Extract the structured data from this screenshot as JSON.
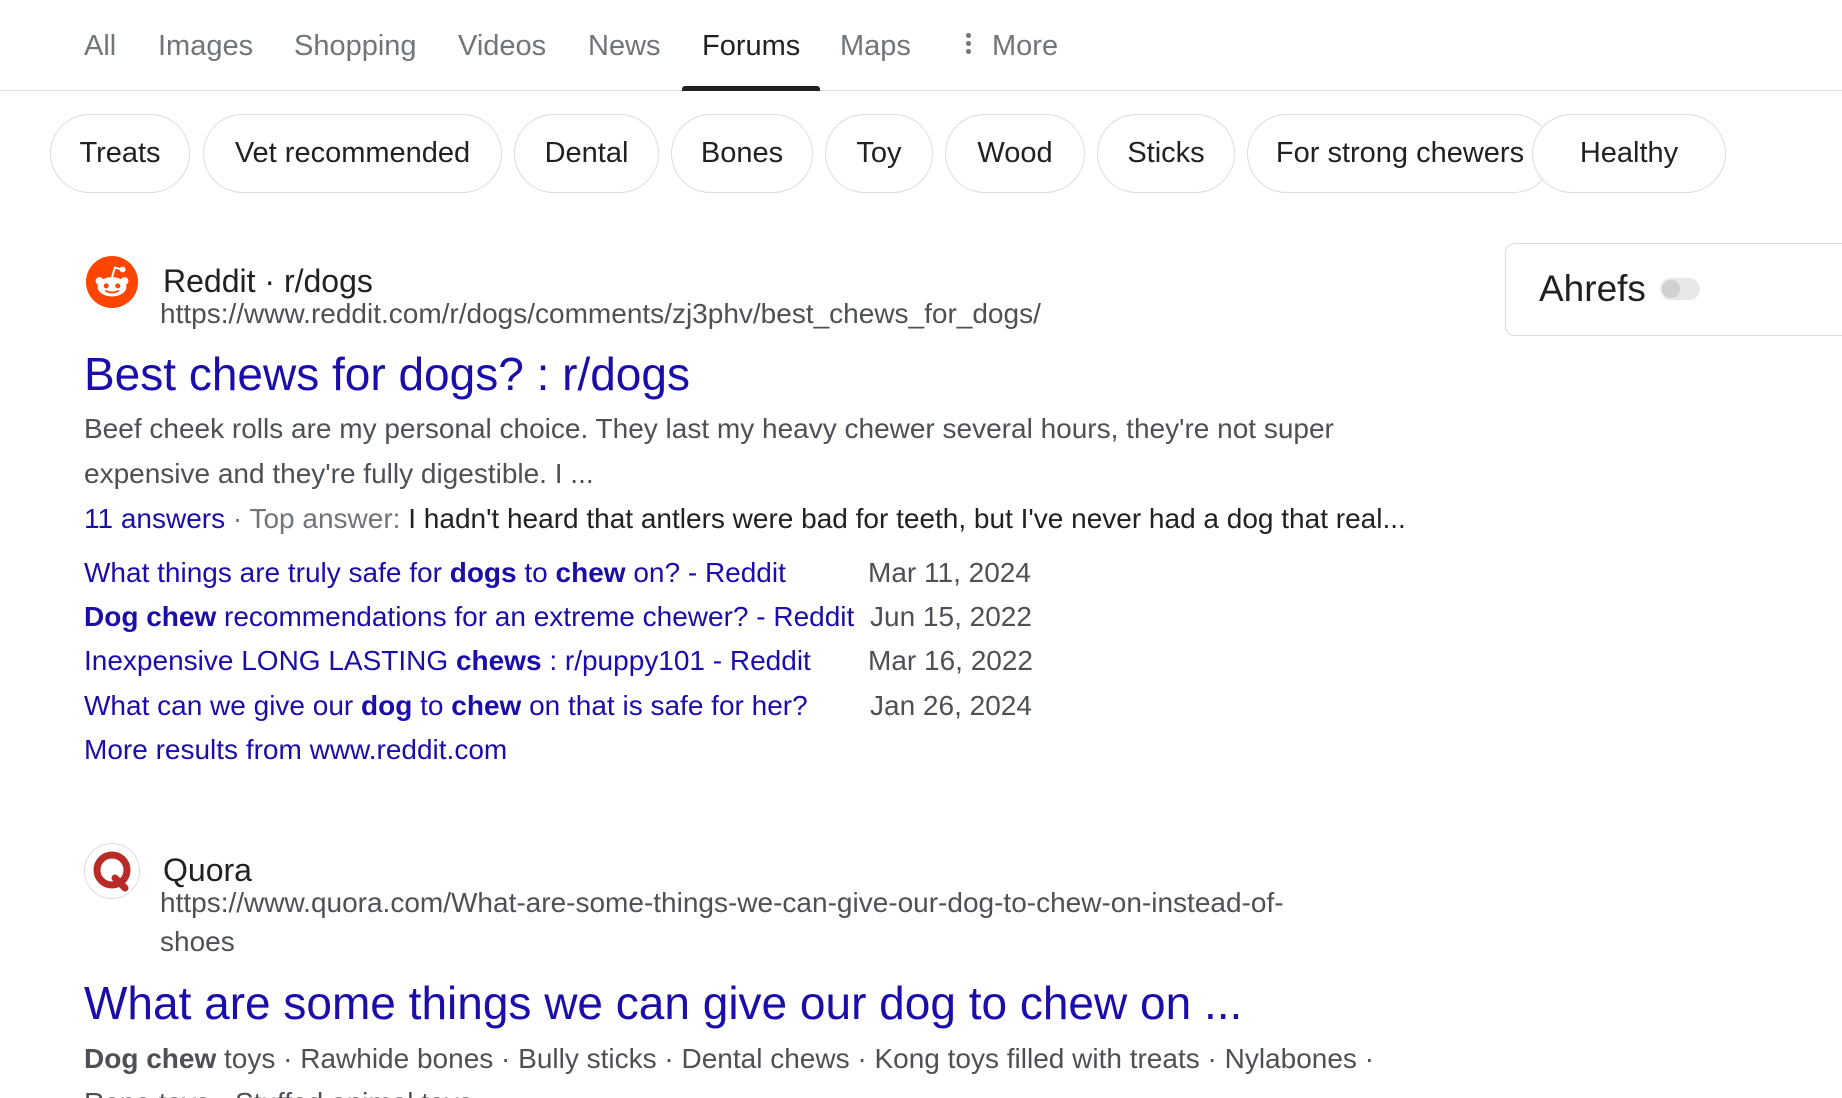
{
  "tabs": [
    {
      "label": "All"
    },
    {
      "label": "Images"
    },
    {
      "label": "Shopping"
    },
    {
      "label": "Videos"
    },
    {
      "label": "News"
    },
    {
      "label": "Forums",
      "active": true
    },
    {
      "label": "Maps"
    },
    {
      "label": "More"
    }
  ],
  "chips": [
    "Treats",
    "Vet recommended",
    "Dental",
    "Bones",
    "Toy",
    "Wood",
    "Sticks",
    "For strong chewers",
    "Healthy"
  ],
  "ahrefs": {
    "label": "Ahrefs"
  },
  "results": [
    {
      "site": "Reddit · r/dogs",
      "url": "https://www.reddit.com/r/dogs/comments/zj3phv/best_chews_for_dogs/",
      "title": "Best chews for dogs? : r/dogs",
      "snippet_lines": [
        "Beef cheek rolls are my personal choice. They last my heavy chewer several hours, they're not super",
        "expensive and they're fully digestible. I ..."
      ],
      "answers": {
        "count": "11 answers",
        "sep": " · Top answer: ",
        "text": "I hadn't heard that antlers were bad for teeth, but I've never had a dog that real..."
      },
      "sub_links": [
        {
          "parts": [
            "What things are truly safe for ",
            "dogs",
            " to ",
            "chew",
            " on? - Reddit"
          ],
          "date": "Mar 11, 2024"
        },
        {
          "parts": [
            "",
            "Dog chew",
            " recommendations for an extreme chewer? - Reddit"
          ],
          "date": "Jun 15, 2022"
        },
        {
          "parts": [
            "Inexpensive LONG LASTING ",
            "chews",
            " : r/puppy101 - Reddit"
          ],
          "date": "Mar 16, 2022"
        },
        {
          "parts": [
            "What can we give our ",
            "dog",
            " to ",
            "chew",
            " on that is safe for her?"
          ],
          "date": "Jan 26, 2024"
        }
      ],
      "more_results": "More results from www.reddit.com"
    },
    {
      "site": "Quora",
      "url_lines": [
        "https://www.quora.com/What-are-some-things-we-can-give-our-dog-to-chew-on-instead-of-",
        "shoes"
      ],
      "title": "What are some things we can give our dog to chew on ...",
      "snippet_parts": [
        "Dog chew",
        " toys · Rawhide bones · Bully sticks · Dental chews · Kong toys filled with treats · Nylabones ·"
      ],
      "snippet_line2": "Rope toys · Stuffed animal toys"
    }
  ],
  "colors": {
    "link": "#1a0dab",
    "text": "#202124",
    "muted": "#4d5156",
    "reddit_orange": "#ff4500",
    "quora_red": "#b92b27"
  }
}
